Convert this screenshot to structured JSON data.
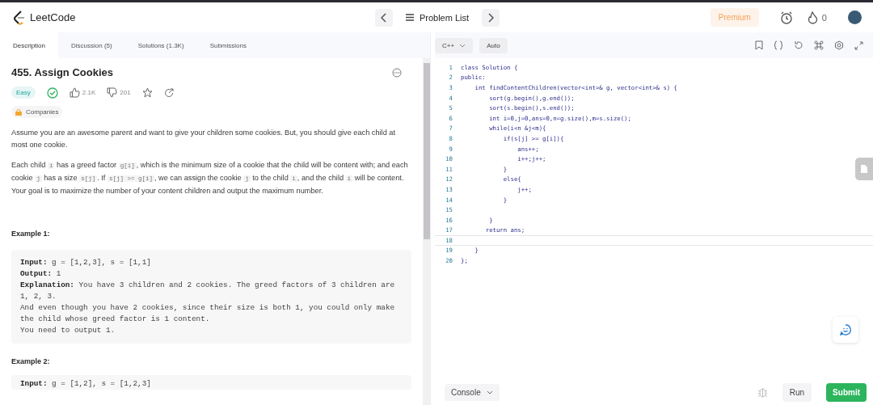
{
  "header": {
    "logo": "LeetCode",
    "nav_label": "Problem List",
    "premium": "Premium",
    "streak": "0"
  },
  "tabs": [
    {
      "label": "Description",
      "selected": true
    },
    {
      "label": "Discussion (5)",
      "selected": false
    },
    {
      "label": "Solutions (1.3K)",
      "selected": false
    },
    {
      "label": "Submissions",
      "selected": false
    }
  ],
  "problem": {
    "title": "455. Assign Cookies",
    "difficulty": "Easy",
    "solved": true,
    "likes": "2.1K",
    "dislikes": "201",
    "companies": "Companies",
    "paragraphs": [
      [
        {
          "kind": "text",
          "text": "Assume you are an awesome parent and want to give your children some cookies. But, you should give each child at most one cookie."
        }
      ],
      [
        {
          "kind": "text",
          "text": "Each child "
        },
        {
          "kind": "code",
          "text": "i"
        },
        {
          "kind": "text",
          "text": " has a greed factor "
        },
        {
          "kind": "code",
          "text": "g[i]"
        },
        {
          "kind": "text",
          "text": ", which is the minimum size of a cookie that the child will be content with; and each cookie "
        },
        {
          "kind": "code",
          "text": "j"
        },
        {
          "kind": "text",
          "text": " has a size "
        },
        {
          "kind": "code",
          "text": "s[j]"
        },
        {
          "kind": "text",
          "text": ". If "
        },
        {
          "kind": "code",
          "text": "s[j] >= g[i]"
        },
        {
          "kind": "text",
          "text": ", we can assign the cookie "
        },
        {
          "kind": "code",
          "text": "j"
        },
        {
          "kind": "text",
          "text": " to the child "
        },
        {
          "kind": "code",
          "text": "i"
        },
        {
          "kind": "text",
          "text": ", and the child "
        },
        {
          "kind": "code",
          "text": "i"
        },
        {
          "kind": "text",
          "text": " will be content. Your goal is to maximize the number of your content children and output the maximum number."
        }
      ]
    ],
    "examples": [
      {
        "title": "Example 1:",
        "lines": [
          "**Input:** g = [1,2,3], s = [1,1]",
          "**Output:** 1",
          "**Explanation:** You have 3 children and 2 cookies. The greed factors of 3 children are 1, 2, 3.",
          "And even though you have 2 cookies, since their size is both 1, you could only make the child whose greed factor is 1 content.",
          "You need to output 1."
        ]
      },
      {
        "title": "Example 2:",
        "lines": [
          "**Input:** g = [1,2], s = [1,2,3]"
        ]
      }
    ]
  },
  "editor": {
    "language": "C++",
    "mode": "Auto",
    "code": [
      {
        "number": "1",
        "text": "class Solution {",
        "current": false
      },
      {
        "number": "2",
        "text": "public:",
        "current": false
      },
      {
        "number": "3",
        "text": "    int findContentChildren(vector<int>& g, vector<int>& s) {",
        "current": false
      },
      {
        "number": "4",
        "text": "        sort(g.begin(),g.end());",
        "current": false
      },
      {
        "number": "5",
        "text": "        sort(s.begin(),s.end());",
        "current": false
      },
      {
        "number": "6",
        "text": "        int i=0,j=0,ans=0,n=g.size(),m=s.size();",
        "current": false
      },
      {
        "number": "7",
        "text": "        while(i<n &j<m){",
        "current": false
      },
      {
        "number": "8",
        "text": "            if(s[j] >= g[i]){",
        "current": false
      },
      {
        "number": "9",
        "text": "                ans++;",
        "current": false
      },
      {
        "number": "10",
        "text": "                i++;j++;",
        "current": false
      },
      {
        "number": "11",
        "text": "            }",
        "current": false
      },
      {
        "number": "12",
        "text": "            else{",
        "current": false
      },
      {
        "number": "13",
        "text": "                j++;",
        "current": false
      },
      {
        "number": "14",
        "text": "            }",
        "current": false
      },
      {
        "number": "15",
        "current": false
      },
      {
        "number": "16",
        "text": "        }",
        "current": false
      },
      {
        "number": "17",
        "text": "       return ans;",
        "current": false
      },
      {
        "number": "18",
        "current": true
      },
      {
        "number": "19",
        "text": "    }",
        "current": false
      },
      {
        "number": "20",
        "text": "};",
        "current": false
      }
    ]
  },
  "footer": {
    "console": "Console",
    "run": "Run",
    "submit": "Submit"
  }
}
